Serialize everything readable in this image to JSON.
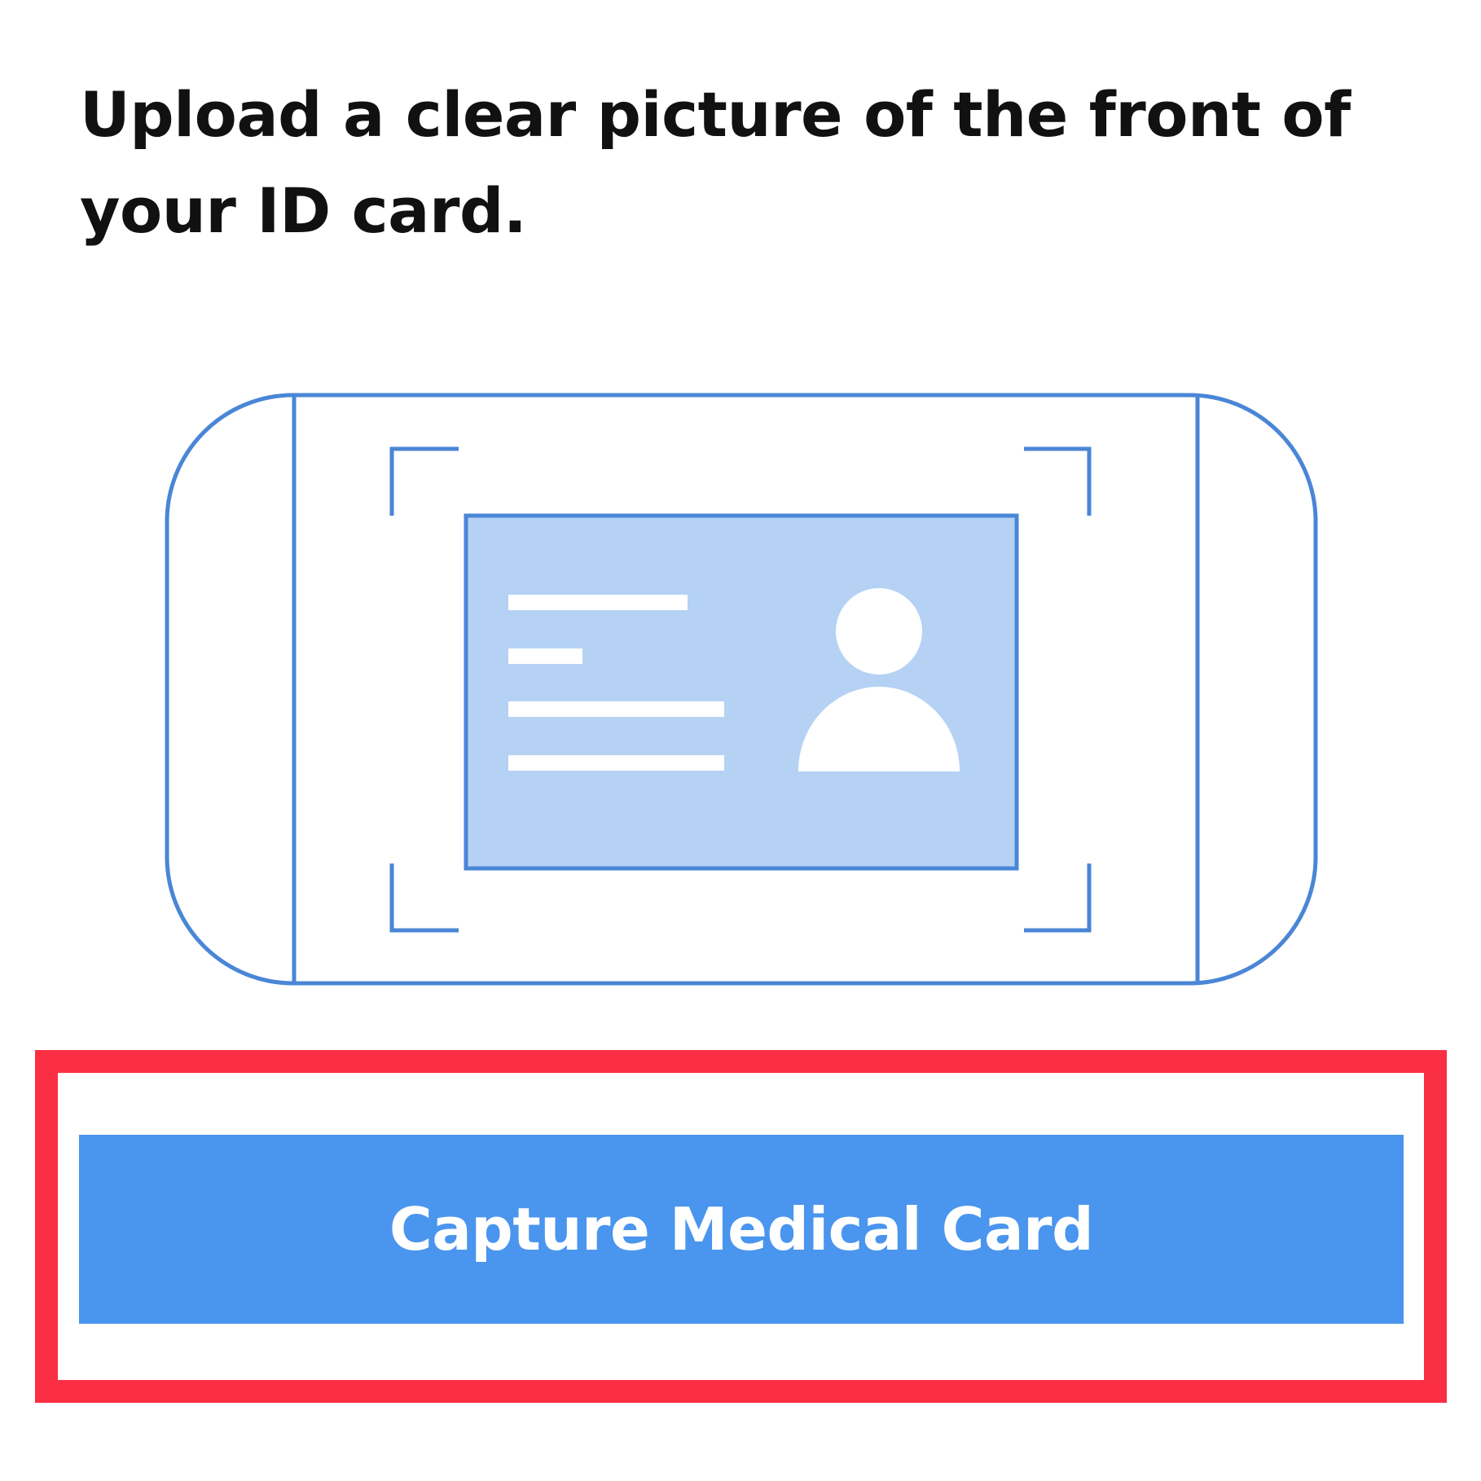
{
  "instruction": {
    "text": "Upload a clear picture of the front of your ID card."
  },
  "illustration": {
    "icon": "phone-scanning-id-card-icon",
    "stroke_color": "#4a86d6",
    "card_fill": "#b5d2f5",
    "detail_fill": "#ffffff"
  },
  "capture_button": {
    "label": "Capture Medical Card",
    "background_color": "#4a95ee",
    "text_color": "#ffffff"
  },
  "highlight": {
    "color": "#fb2f44"
  }
}
